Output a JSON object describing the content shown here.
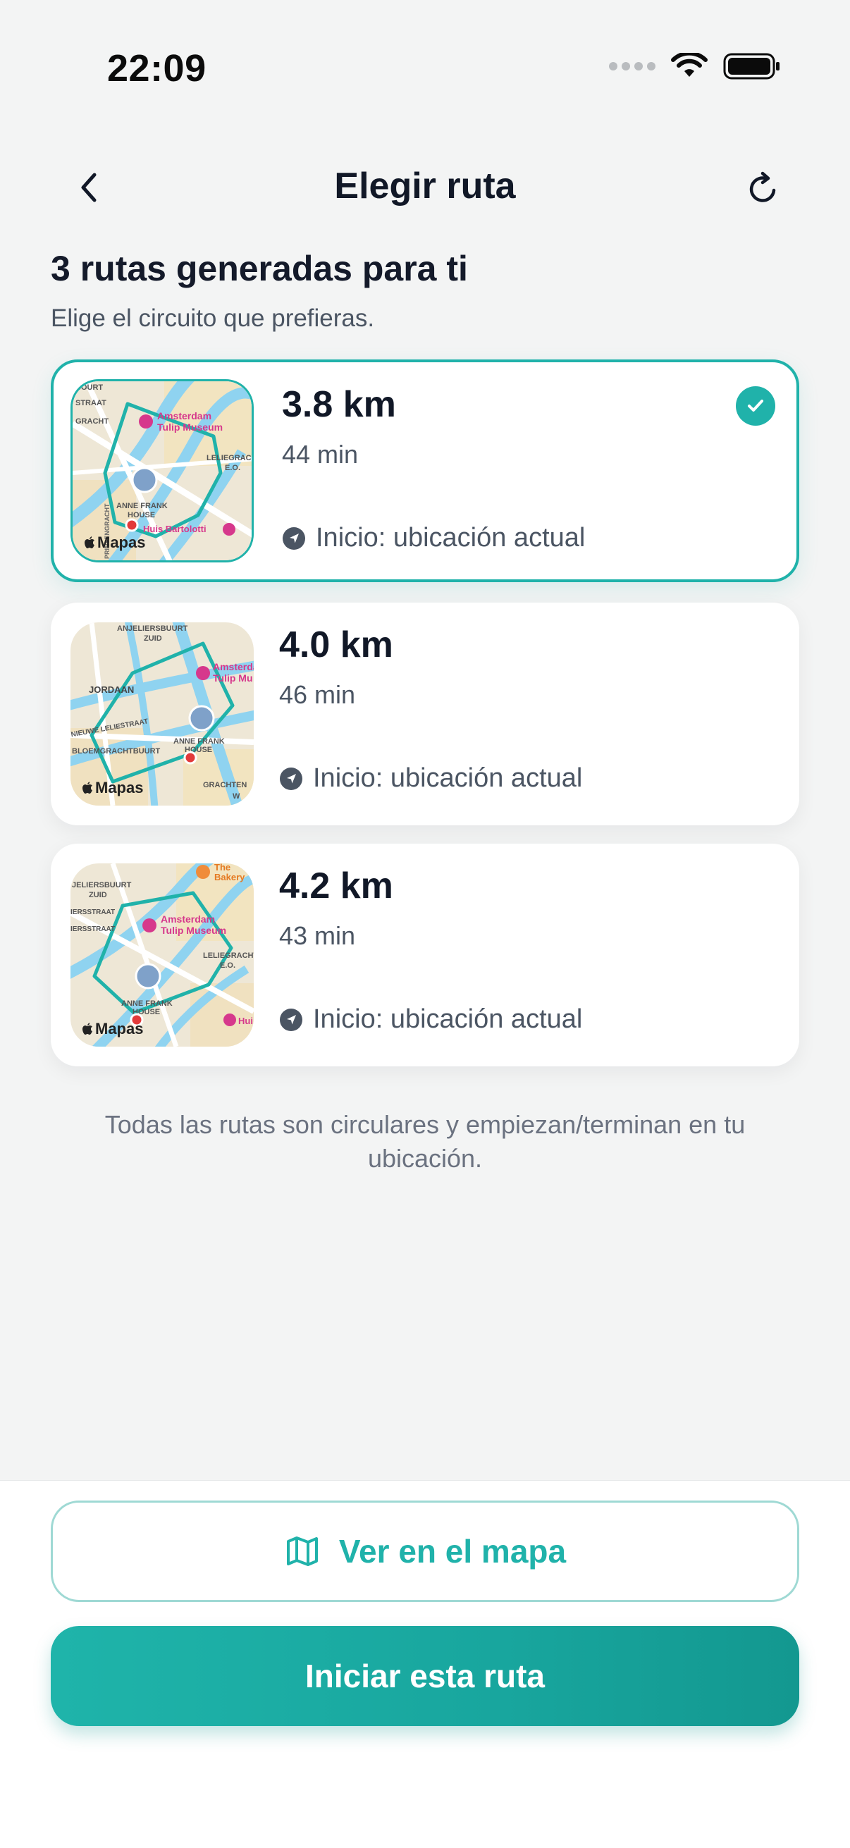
{
  "status_bar": {
    "time": "22:09"
  },
  "header": {
    "title": "Elegir ruta",
    "back_icon": "chevron-left-icon",
    "refresh_icon": "refresh-icon"
  },
  "section": {
    "title": "3 rutas generadas para ti",
    "subtitle": "Elige el circuito que prefieras."
  },
  "routes": [
    {
      "distance": "3.8 km",
      "duration": "44 min",
      "start": "Inicio: ubicación actual",
      "selected": true,
      "map": {
        "brand": "Mapas",
        "labels": [
          "BOURT",
          "STRAAT",
          "GRACHT",
          "Amsterdam",
          "Tulip Museum",
          "LELIEGRACHT",
          "E.O.",
          "ANNE FRANK",
          "HOUSE",
          "Huis Bartolotti",
          "PRINSENGRACHT"
        ]
      }
    },
    {
      "distance": "4.0 km",
      "duration": "46 min",
      "start": "Inicio: ubicación actual",
      "selected": false,
      "map": {
        "brand": "Mapas",
        "labels": [
          "ANJELIERSBUURT",
          "ZUID",
          "JORDAAN",
          "NIEUWE LELIESTRAAT",
          "BLOEMGRACHTBUURT",
          "Amsterdam",
          "Tulip Mu",
          "ANNE FRANK",
          "HOUSE",
          "GRACHTEN",
          "W"
        ]
      }
    },
    {
      "distance": "4.2 km",
      "duration": "43 min",
      "start": "Inicio: ubicación actual",
      "selected": false,
      "map": {
        "brand": "Mapas",
        "labels": [
          "JELIERSBUURT",
          "ZUID",
          "IERSSTRAAT",
          "IERSSTRAAT",
          "The",
          "Bakery",
          "Amsterdam",
          "Tulip Museum",
          "LELIEGRACHT",
          "E.O.",
          "ANNE FRANK",
          "HOUSE",
          "Hui"
        ]
      }
    }
  ],
  "footnote": "Todas las rutas son circulares y empiezan/terminan en tu ubicación.",
  "actions": {
    "map_button": "Ver en el mapa",
    "start_button": "Iniciar esta ruta"
  },
  "colors": {
    "accent": "#20B2AA",
    "background": "#F3F4F4",
    "poi_pink": "#D6388C",
    "start_dot": "#E23A3A"
  }
}
